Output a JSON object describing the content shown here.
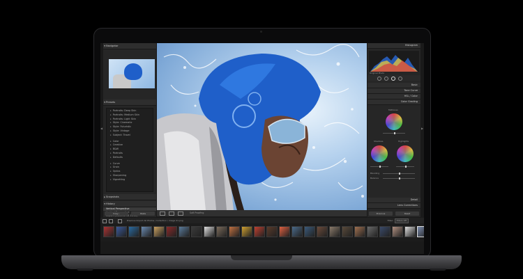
{
  "left_panel": {
    "navigator_label": "Navigator",
    "presets_label": "Presets",
    "preset_items": [
      "Portraits: Deep Skin",
      "Portraits: Medium Skin",
      "Portraits: Light Skin",
      "Style: Cinematic",
      "Style: Futuristic",
      "Style: Vintage",
      "Subject: Travel",
      "Color",
      "Creative",
      "B&W",
      "Portraits",
      "Defaults",
      "Curve",
      "Grain",
      "Optics",
      "Sharpening",
      "Vignetting"
    ],
    "snapshots_label": "Snapshots",
    "history_label": "History",
    "history_items": [
      "Vertical Perspective",
      "Vertical Perspective",
      "Import (2024-01-14 16:43)"
    ],
    "copy_label": "Copy...",
    "paste_label": "Paste"
  },
  "toolbar": {
    "soft_proofing_label": "Soft Proofing"
  },
  "right_panel": {
    "histogram_label": "Histogram",
    "original_photo_label": "Original Photo",
    "panels": [
      "Basic",
      "Tone Curve",
      "HSL / Color",
      "Color Grading"
    ],
    "color_grading_label": "Color Grading",
    "midtones_label": "Midtones",
    "shadows_label": "Shadows",
    "highlights_label": "Highlights",
    "blending_label": "Blending",
    "balance_label": "Balance",
    "detail_label": "Detail",
    "lens_label": "Lens Corrections",
    "previous_label": "Previous",
    "reset_label": "Reset"
  },
  "filmstrip_bar": {
    "path_text": "Previous Import   All Photos / Collection / image 01.png",
    "filter_label": "Filter:",
    "filter_value": "Filters Off"
  },
  "colors": {
    "panel_bg": "#262626",
    "hood_blue": "#1f5fc9",
    "sky_blue": "#7fa9d7"
  }
}
